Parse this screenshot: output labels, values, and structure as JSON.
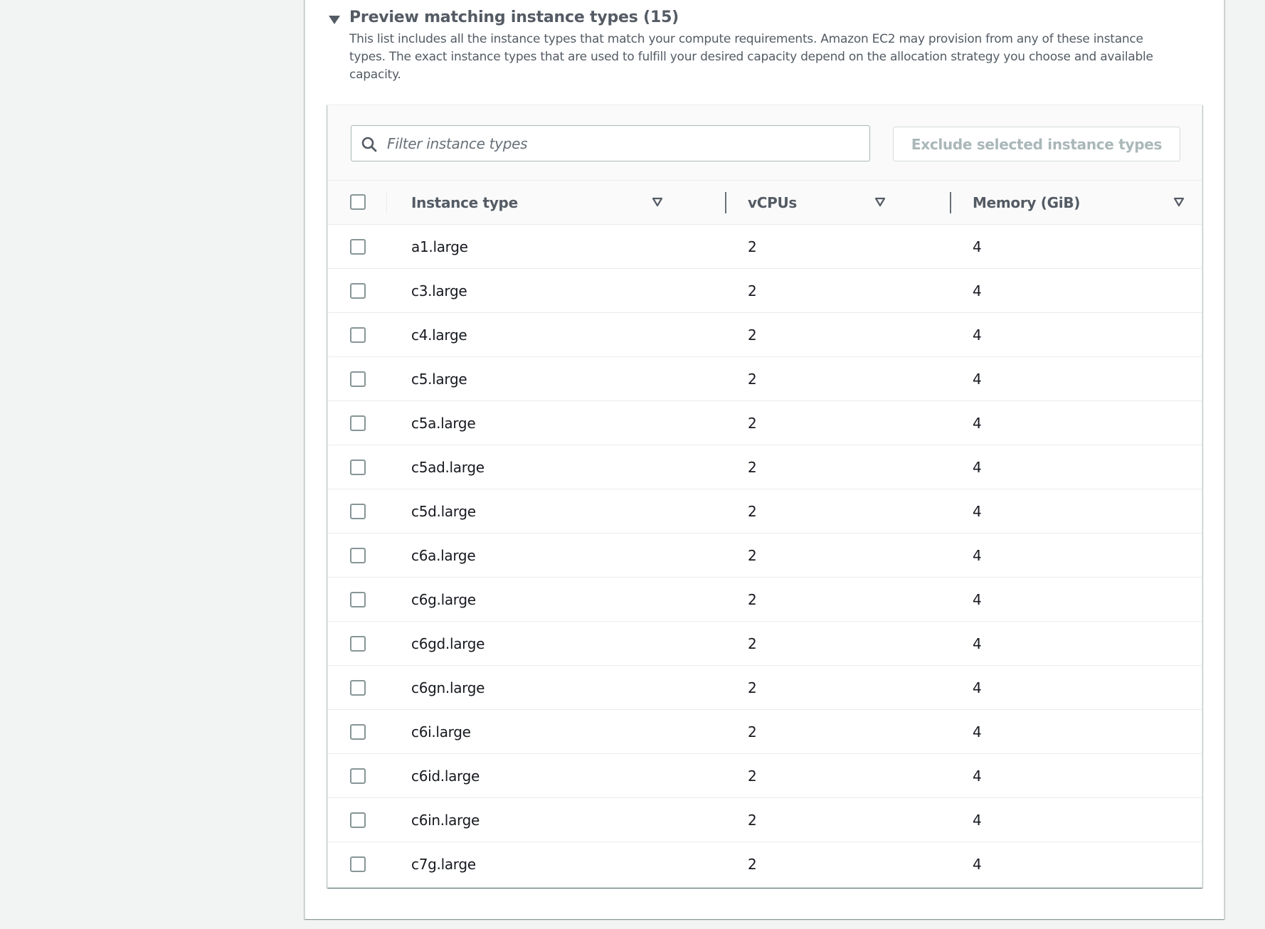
{
  "section": {
    "title": "Preview matching instance types (15)",
    "description": "This list includes all the instance types that match your compute requirements. Amazon EC2 may provision from any of these instance types. The exact instance types that are used to fulfill your desired capacity depend on the allocation strategy you choose and available capacity.",
    "expanded": true,
    "caret_icon": "caret-down-icon"
  },
  "toolbar": {
    "filter_placeholder": "Filter instance types",
    "filter_value": "",
    "search_icon": "search-icon",
    "exclude_button_label": "Exclude selected instance types",
    "exclude_button_disabled": true
  },
  "table": {
    "columns": [
      {
        "key": "instance_type",
        "label": "Instance type"
      },
      {
        "key": "vcpus",
        "label": "vCPUs"
      },
      {
        "key": "memory",
        "label": "Memory (GiB)"
      }
    ],
    "rows": [
      {
        "instance_type": "a1.large",
        "vcpus": "2",
        "memory": "4",
        "selected": false
      },
      {
        "instance_type": "c3.large",
        "vcpus": "2",
        "memory": "4",
        "selected": false
      },
      {
        "instance_type": "c4.large",
        "vcpus": "2",
        "memory": "4",
        "selected": false
      },
      {
        "instance_type": "c5.large",
        "vcpus": "2",
        "memory": "4",
        "selected": false
      },
      {
        "instance_type": "c5a.large",
        "vcpus": "2",
        "memory": "4",
        "selected": false
      },
      {
        "instance_type": "c5ad.large",
        "vcpus": "2",
        "memory": "4",
        "selected": false
      },
      {
        "instance_type": "c5d.large",
        "vcpus": "2",
        "memory": "4",
        "selected": false
      },
      {
        "instance_type": "c6a.large",
        "vcpus": "2",
        "memory": "4",
        "selected": false
      },
      {
        "instance_type": "c6g.large",
        "vcpus": "2",
        "memory": "4",
        "selected": false
      },
      {
        "instance_type": "c6gd.large",
        "vcpus": "2",
        "memory": "4",
        "selected": false
      },
      {
        "instance_type": "c6gn.large",
        "vcpus": "2",
        "memory": "4",
        "selected": false
      },
      {
        "instance_type": "c6i.large",
        "vcpus": "2",
        "memory": "4",
        "selected": false
      },
      {
        "instance_type": "c6id.large",
        "vcpus": "2",
        "memory": "4",
        "selected": false
      },
      {
        "instance_type": "c6in.large",
        "vcpus": "2",
        "memory": "4",
        "selected": false
      },
      {
        "instance_type": "c7g.large",
        "vcpus": "2",
        "memory": "4",
        "selected": false
      }
    ]
  },
  "colors": {
    "page_background": "#f2f3f3",
    "heading_text": "#545b64",
    "body_text": "#16191f",
    "disabled_text": "#aab7b8",
    "border": "#eaeded"
  }
}
